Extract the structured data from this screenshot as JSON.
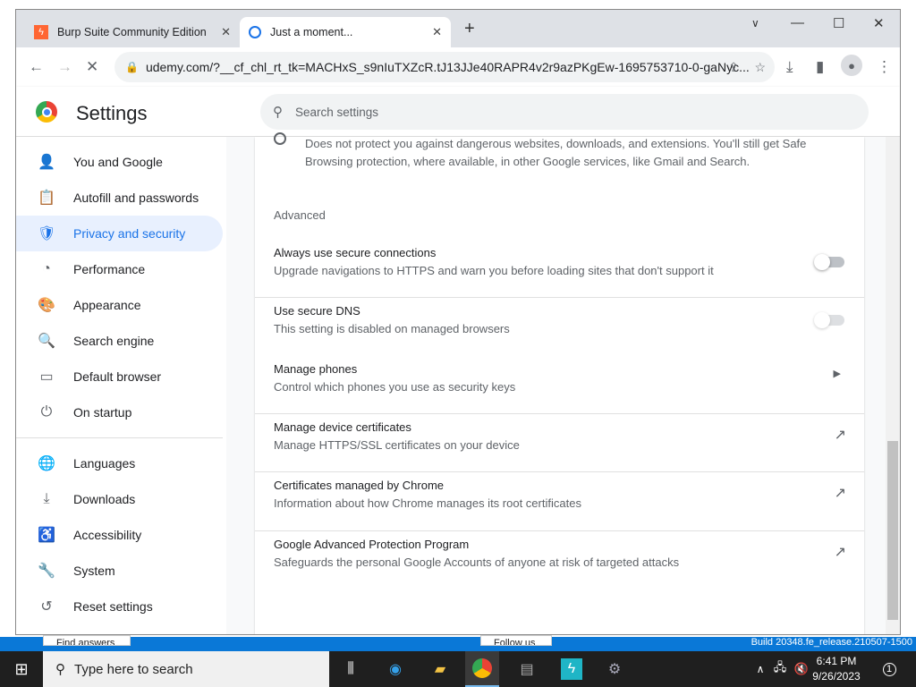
{
  "background": {
    "find_answers": "Find answers",
    "follow_us": "Follow us",
    "build": "Build 20348.fe_release.210507-1500"
  },
  "tabs": [
    {
      "label": "Burp Suite Community Edition",
      "icon": "burp-icon",
      "color": "#ff6633"
    },
    {
      "label": "Just a moment...",
      "icon": "loading-icon",
      "active": true
    }
  ],
  "toolbar": {
    "url": "udemy.com/?__cf_chl_rt_tk=MACHxS_s9nIuTXZcR.tJ13JJe40RAPR4v2r9azPKgEw-1695753710-0-gaNyc..."
  },
  "settings": {
    "title": "Settings",
    "search_placeholder": "Search settings"
  },
  "sidebar": {
    "items": [
      {
        "label": "You and Google",
        "icon": "person-icon",
        "glyph": "👤"
      },
      {
        "label": "Autofill and passwords",
        "icon": "clipboard-icon",
        "glyph": "📋"
      },
      {
        "label": "Privacy and security",
        "icon": "shield-icon",
        "glyph": "🛡",
        "selected": true
      },
      {
        "label": "Performance",
        "icon": "gauge-icon",
        "glyph": "◔"
      },
      {
        "label": "Appearance",
        "icon": "palette-icon",
        "glyph": "🎨"
      },
      {
        "label": "Search engine",
        "icon": "search-icon",
        "glyph": "🔍"
      },
      {
        "label": "Default browser",
        "icon": "browser-icon",
        "glyph": "▭"
      },
      {
        "label": "On startup",
        "icon": "power-icon",
        "glyph": "⏻"
      },
      {
        "label": "Languages",
        "icon": "globe-icon",
        "glyph": "🌐"
      },
      {
        "label": "Downloads",
        "icon": "download-icon",
        "glyph": "⤓"
      },
      {
        "label": "Accessibility",
        "icon": "accessibility-icon",
        "glyph": "♿"
      },
      {
        "label": "System",
        "icon": "wrench-icon",
        "glyph": "🔧"
      },
      {
        "label": "Reset settings",
        "icon": "history-icon",
        "glyph": "↺"
      }
    ]
  },
  "main": {
    "no_protection_desc": "Does not protect you against dangerous websites, downloads, and extensions. You'll still get Safe",
    "no_protection_desc2": "Browsing protection, where available, in other Google services, like Gmail and Search.",
    "advanced": "Advanced",
    "rows": [
      {
        "title": "Always use secure connections",
        "sub": "Upgrade navigations to HTTPS and warn you before loading sites that don't support it",
        "control": "toggle",
        "on": false
      },
      {
        "title": "Use secure DNS",
        "sub": "This setting is disabled on managed browsers",
        "control": "toggle",
        "on": false,
        "disabled": true
      },
      {
        "title": "Manage phones",
        "sub": "Control which phones you use as security keys",
        "control": "arrow"
      },
      {
        "title": "Manage device certificates",
        "sub": "Manage HTTPS/SSL certificates on your device",
        "control": "external-link"
      },
      {
        "title": "Certificates managed by Chrome",
        "sub": "Information about how Chrome manages its root certificates",
        "control": "external-link"
      },
      {
        "title": "Google Advanced Protection Program",
        "sub": "Safeguards the personal Google Accounts of anyone at risk of targeted attacks",
        "control": "external-link"
      }
    ]
  },
  "taskbar": {
    "search_placeholder": "Type here to search",
    "time": "6:41 PM",
    "date": "9/26/2023",
    "notifications": "1"
  }
}
